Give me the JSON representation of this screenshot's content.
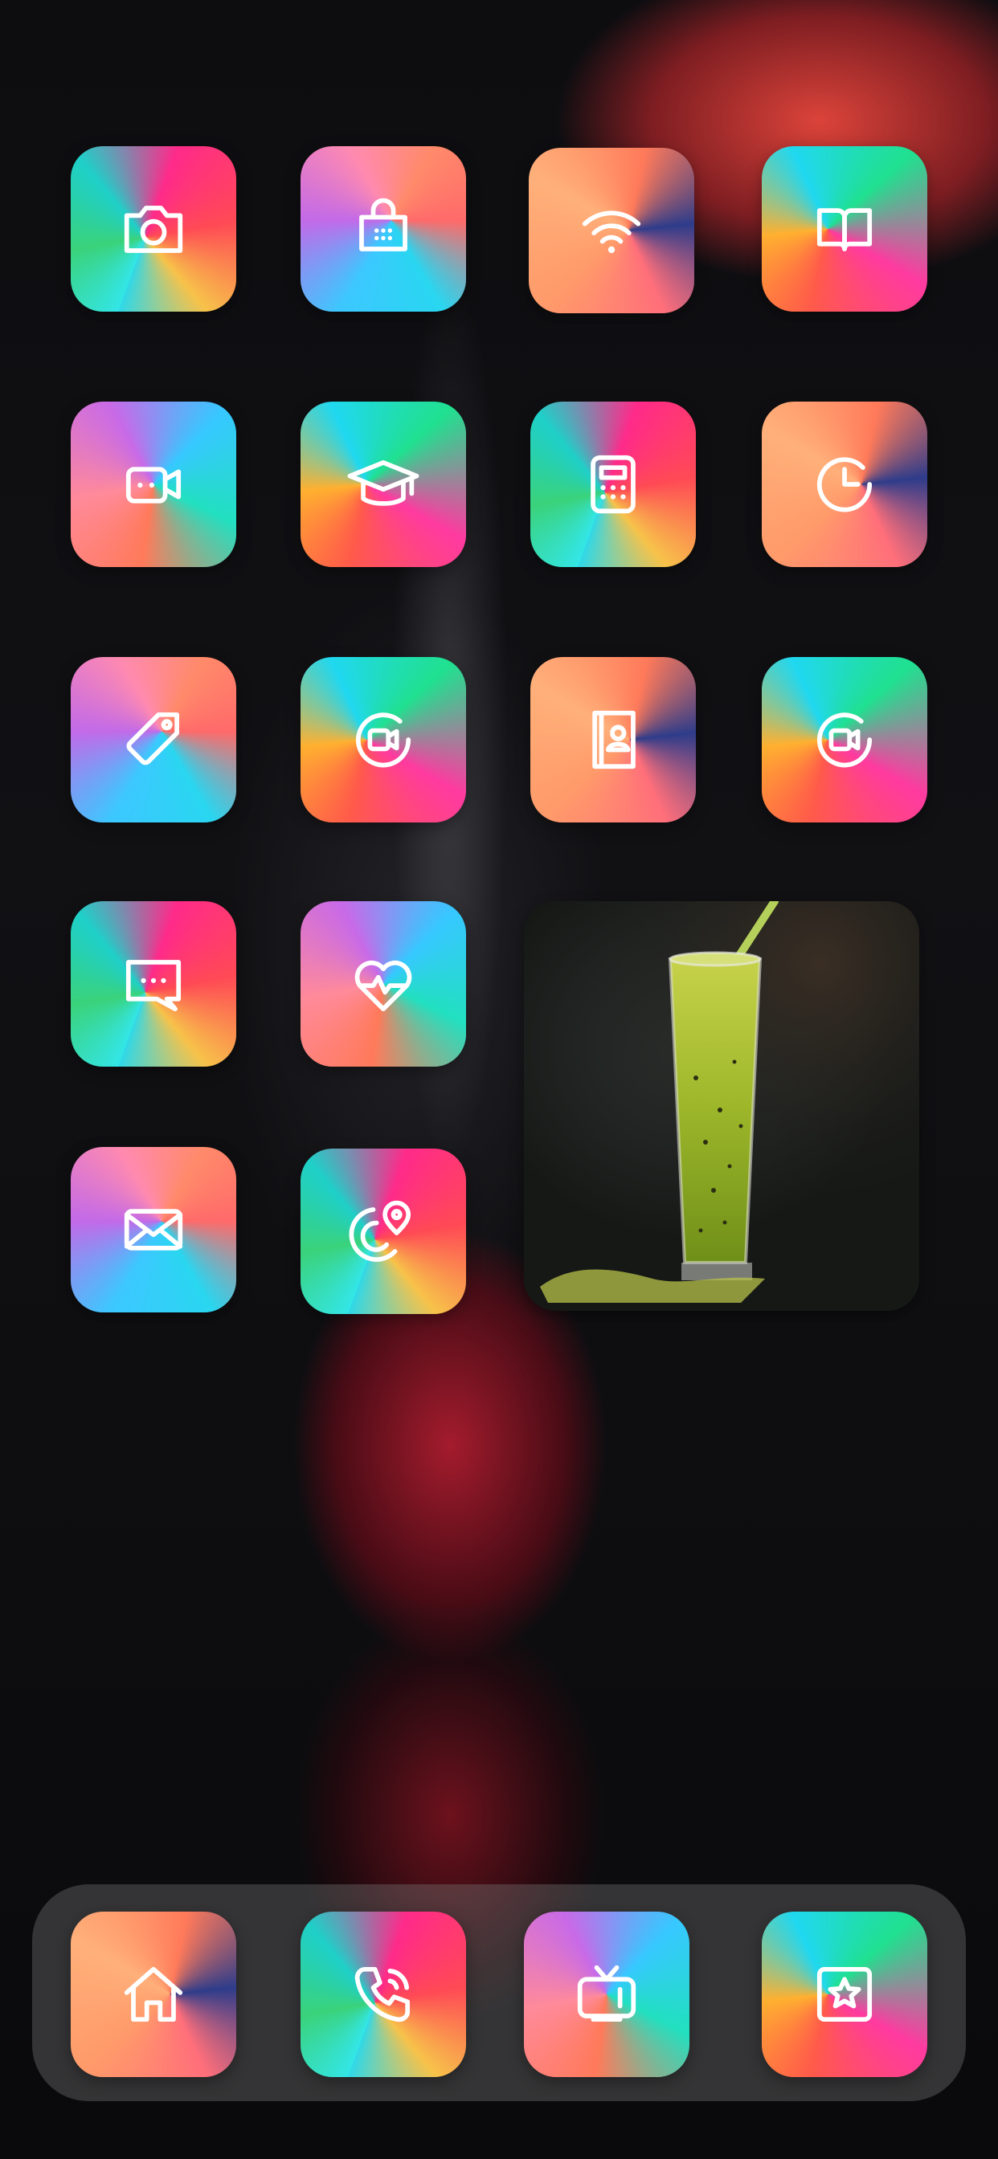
{
  "screen": {
    "wallpaper": "blurred-red-drink-glass",
    "accent_colors": [
      "#33e6e6",
      "#ff2a8a",
      "#ff8a6a",
      "#3ad27a",
      "#c26ae8"
    ]
  },
  "home": {
    "rows": [
      [
        {
          "icon": "camera-icon"
        },
        {
          "icon": "store-icon"
        },
        {
          "icon": "wifi-icon"
        },
        {
          "icon": "book-icon"
        }
      ],
      [
        {
          "icon": "video-camera-icon"
        },
        {
          "icon": "graduation-cap-icon"
        },
        {
          "icon": "calculator-icon"
        },
        {
          "icon": "clock-icon"
        }
      ],
      [
        {
          "icon": "tag-icon"
        },
        {
          "icon": "video-record-icon"
        },
        {
          "icon": "contacts-book-icon"
        },
        {
          "icon": "video-record-icon"
        }
      ],
      [
        {
          "icon": "message-icon"
        },
        {
          "icon": "heart-pulse-icon"
        }
      ],
      [
        {
          "icon": "mail-icon"
        },
        {
          "icon": "location-icon"
        }
      ]
    ],
    "widget": {
      "type": "photo",
      "subject": "green-smoothie-glass"
    }
  },
  "dock": {
    "apps": [
      {
        "icon": "home-icon"
      },
      {
        "icon": "phone-icon"
      },
      {
        "icon": "tv-icon"
      },
      {
        "icon": "star-icon"
      }
    ]
  }
}
